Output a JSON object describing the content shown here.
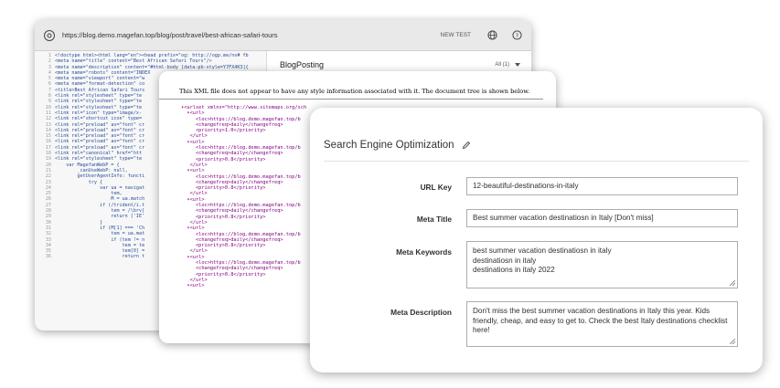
{
  "browser": {
    "url": "https://blog.demo.magefan.top/blog/post/travel/best-african-safari-tours",
    "new_test": "NEW TEST"
  },
  "code_lines": [
    "<!doctype html><html lang=\"en\"><head prefix=\"og: http://ogp.me/ns# fb",
    "<meta name=\"title\" content=\"Best African Safari Tours\"/>",
    "<meta name=\"description\" content=\"#html-body [data-pb-style=Y7FX4K3]{",
    "<meta name=\"robots\" content=\"INDEX",
    "<meta name=\"viewport\" content=\"w",
    "<meta name=\"format-detection\" co",
    "<title>Best African Safari Tours",
    "<link rel=\"stylesheet\" type=\"te",
    "<link rel=\"stylesheet\" type=\"te",
    "<link rel=\"stylesheet\" type=\"te",
    "<link rel=\"icon\" type=\"image/x-",
    "<link rel=\"shortcut icon\" type=",
    "<link rel=\"preload\" as=\"font\" cr",
    "<link rel=\"preload\" as=\"font\" cr",
    "<link rel=\"preload\" as=\"font\" cr",
    "<link rel=\"preload\" as=\"font\" cr",
    "<link rel=\"preload\" as=\"font\" cr",
    "<link rel=\"canonical\" href=\"htt",
    "<link rel=\"stylesheet\" type=\"te",
    "    var MagefanWebP = {",
    "        _canUseWebP: null,",
    "        getUserAgentInfo: functi",
    "            try {",
    "                var ua = navigat",
    "                    tem,",
    "                    M = ua.match",
    "                if (/trident/i.t",
    "                    tem = /\\brv[",
    "                    return ['IE'",
    "                }",
    "                if (M[1] === 'Ch",
    "                    tem = ua.mat",
    "                    if (tem != n",
    "                        tem = te",
    "                        tem[0] =",
    "                        return t"
  ],
  "right_pane": {
    "title": "BlogPosting",
    "select_value": "All (1)"
  },
  "xml": {
    "note": "This XML file does not appear to have any style information associated with it. The document tree is shown below.",
    "lines": [
      "▾<urlset xmlns=\"http://www.sitemaps.org/sch",
      "  ▾<url>",
      "     <loc>https://blog.demo.magefan.top/b",
      "     <changefreq>daily</changefreq>",
      "     <priority>1.0</priority>",
      "   </url>",
      "  ▾<url>",
      "     <loc>https://blog.demo.magefan.top/b",
      "     <changefreq>daily</changefreq>",
      "     <priority>0.8</priority>",
      "   </url>",
      "  ▾<url>",
      "     <loc>https://blog.demo.magefan.top/b",
      "     <changefreq>daily</changefreq>",
      "     <priority>0.8</priority>",
      "   </url>",
      "  ▾<url>",
      "     <loc>https://blog.demo.magefan.top/b",
      "     <changefreq>daily</changefreq>",
      "     <priority>0.8</priority>",
      "   </url>",
      "  ▾<url>",
      "     <loc>https://blog.demo.magefan.top/b",
      "     <changefreq>daily</changefreq>",
      "     <priority>0.8</priority>",
      "   </url>",
      "  ▾<url>",
      "     <loc>https://blog.demo.magefan.top/b",
      "     <changefreq>daily</changefreq>",
      "     <priority>0.8</priority>",
      "   </url>",
      "  ▾<url>"
    ]
  },
  "seo": {
    "title": "Search Engine Optimization",
    "url_key_label": "URL Key",
    "url_key_value": "12-beautiful-destinations-in-italy",
    "meta_title_label": "Meta Title",
    "meta_title_value": "Best summer vacation destinatiosn in Italy [Don't miss]",
    "meta_keywords_label": "Meta Keywords",
    "meta_keywords_lines": [
      "best summer vacation destinatiosn in italy",
      "destinatiosn in italy",
      "destinations in italy 2022"
    ],
    "meta_description_label": "Meta Description",
    "meta_description_value": "Don't miss the best summer vacation destinations in Italy this year. Kids friendly, cheap, and easy to get to. Check the best Italy destinations checklist here!"
  },
  "colors": {
    "code_text": "#2a4f9a",
    "xml_tag": "#800080",
    "border": "#adadad"
  }
}
